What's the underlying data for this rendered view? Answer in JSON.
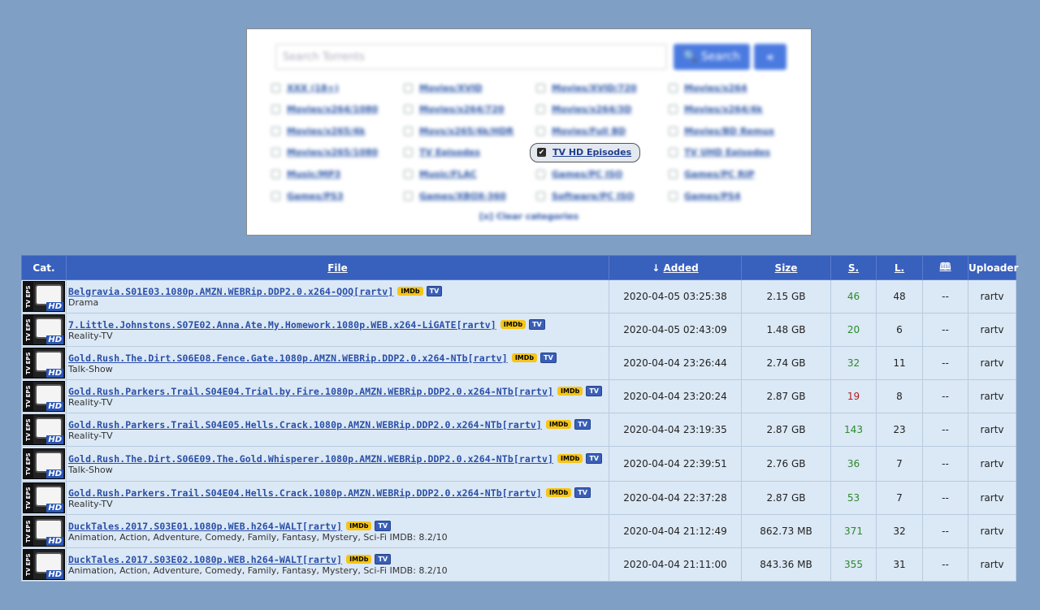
{
  "search": {
    "placeholder": "Search Torrents",
    "button_label": "🔍 Search",
    "collapse_label": "«",
    "clear_label": "[x] Clear categories",
    "categories": [
      {
        "label": "XXX (18+)",
        "checked": false
      },
      {
        "label": "Movies/XVID",
        "checked": false
      },
      {
        "label": "Movies/XVID/720",
        "checked": false
      },
      {
        "label": "Movies/x264",
        "checked": false
      },
      {
        "label": "Movies/x264/1080",
        "checked": false
      },
      {
        "label": "Movies/x264/720",
        "checked": false
      },
      {
        "label": "Movies/x264/3D",
        "checked": false
      },
      {
        "label": "Movies/x264/4k",
        "checked": false
      },
      {
        "label": "Movies/x265/4k",
        "checked": false
      },
      {
        "label": "Movs/x265/4k/HDR",
        "checked": false
      },
      {
        "label": "Movies/Full BD",
        "checked": false
      },
      {
        "label": "Movies/BD Remux",
        "checked": false
      },
      {
        "label": "Movies/x265/1080",
        "checked": false
      },
      {
        "label": "TV Episodes",
        "checked": false
      },
      {
        "label": "TV HD Episodes",
        "checked": true
      },
      {
        "label": "TV UHD Episodes",
        "checked": false
      },
      {
        "label": "Music/MP3",
        "checked": false
      },
      {
        "label": "Music/FLAC",
        "checked": false
      },
      {
        "label": "Games/PC ISO",
        "checked": false
      },
      {
        "label": "Games/PC RIP",
        "checked": false
      },
      {
        "label": "Games/PS3",
        "checked": false
      },
      {
        "label": "Games/XBOX-360",
        "checked": false
      },
      {
        "label": "Software/PC ISO",
        "checked": false
      },
      {
        "label": "Games/PS4",
        "checked": false
      }
    ]
  },
  "table": {
    "headers": {
      "cat": "Cat.",
      "file": "File",
      "added": "Added",
      "added_arrow": "↓",
      "size": "Size",
      "seeders": "S.",
      "leechers": "L.",
      "comments_icon": "🕮",
      "uploader": "Uploader"
    },
    "category_icon": {
      "side": "TV EPS",
      "badge": "HD"
    },
    "badges": {
      "imdb": "IMDb",
      "tv": "TV"
    },
    "rows": [
      {
        "file": "Belgravia.S01E03.1080p.AMZN.WEBRip.DDP2.0.x264-QOQ[rartv]",
        "genre": "Drama",
        "added": "2020-04-05 03:25:38",
        "size": "2.15 GB",
        "seeders": "46",
        "leechers": "48",
        "comments": "--",
        "uploader": "rartv"
      },
      {
        "file": "7.Little.Johnstons.S07E02.Anna.Ate.My.Homework.1080p.WEB.x264-LiGATE[rartv]",
        "genre": "Reality-TV",
        "added": "2020-04-05 02:43:09",
        "size": "1.48 GB",
        "seeders": "20",
        "leechers": "6",
        "comments": "--",
        "uploader": "rartv"
      },
      {
        "file": "Gold.Rush.The.Dirt.S06E08.Fence.Gate.1080p.AMZN.WEBRip.DDP2.0.x264-NTb[rartv]",
        "genre": "Talk-Show",
        "added": "2020-04-04 23:26:44",
        "size": "2.74 GB",
        "seeders": "32",
        "leechers": "11",
        "comments": "--",
        "uploader": "rartv"
      },
      {
        "file": "Gold.Rush.Parkers.Trail.S04E04.Trial.by.Fire.1080p.AMZN.WEBRip.DDP2.0.x264-NTb[rartv]",
        "genre": "Reality-TV",
        "added": "2020-04-04 23:20:24",
        "size": "2.87 GB",
        "seeders": "19",
        "leechers": "8",
        "comments": "--",
        "uploader": "rartv"
      },
      {
        "file": "Gold.Rush.Parkers.Trail.S04E05.Hells.Crack.1080p.AMZN.WEBRip.DDP2.0.x264-NTb[rartv]",
        "genre": "Reality-TV",
        "added": "2020-04-04 23:19:35",
        "size": "2.87 GB",
        "seeders": "143",
        "leechers": "23",
        "comments": "--",
        "uploader": "rartv"
      },
      {
        "file": "Gold.Rush.The.Dirt.S06E09.The.Gold.Whisperer.1080p.AMZN.WEBRip.DDP2.0.x264-NTb[rartv]",
        "genre": "Talk-Show",
        "added": "2020-04-04 22:39:51",
        "size": "2.76 GB",
        "seeders": "36",
        "leechers": "7",
        "comments": "--",
        "uploader": "rartv"
      },
      {
        "file": "Gold.Rush.Parkers.Trail.S04E04.Hells.Crack.1080p.AMZN.WEBRip.DDP2.0.x264-NTb[rartv]",
        "genre": "Reality-TV",
        "added": "2020-04-04 22:37:28",
        "size": "2.87 GB",
        "seeders": "53",
        "leechers": "7",
        "comments": "--",
        "uploader": "rartv"
      },
      {
        "file": "DuckTales.2017.S03E01.1080p.WEB.h264-WALT[rartv]",
        "genre": "Animation, Action, Adventure, Comedy, Family, Fantasy, Mystery, Sci-Fi IMDB: 8.2/10",
        "added": "2020-04-04 21:12:49",
        "size": "862.73 MB",
        "seeders": "371",
        "leechers": "32",
        "comments": "--",
        "uploader": "rartv"
      },
      {
        "file": "DuckTales.2017.S03E02.1080p.WEB.h264-WALT[rartv]",
        "genre": "Animation, Action, Adventure, Comedy, Family, Fantasy, Mystery, Sci-Fi IMDB: 8.2/10",
        "added": "2020-04-04 21:11:00",
        "size": "843.36 MB",
        "seeders": "355",
        "leechers": "31",
        "comments": "--",
        "uploader": "rartv"
      }
    ]
  },
  "colors": {
    "page_bg": "#7f9fc5",
    "header_bg": "#3860bd",
    "row_bg": "#dbe8f5",
    "link": "#2a4fa8",
    "seed_good": "#2a8a2a",
    "seed_bad": "#b02020"
  }
}
